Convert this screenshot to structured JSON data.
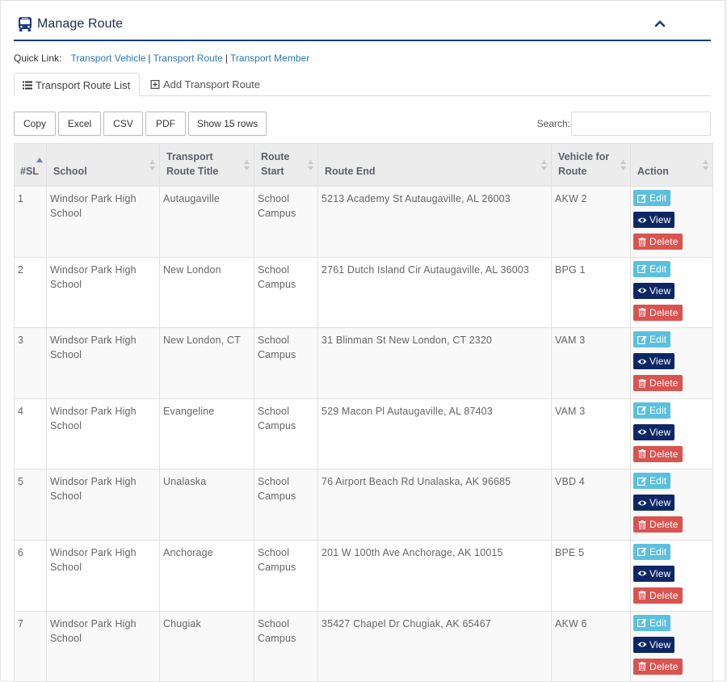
{
  "panel": {
    "title": "Manage Route",
    "title_icon": "bus-icon",
    "collapse_icon": "chevron-up-icon"
  },
  "quick_link": {
    "label": "Quick Link:",
    "links": [
      "Transport Vehicle",
      "Transport Route",
      "Transport Member"
    ],
    "separator": "|"
  },
  "tabs": [
    {
      "label": "Transport Route List",
      "icon": "list-icon",
      "active": true
    },
    {
      "label": "Add Transport Route",
      "icon": "plus-square-icon",
      "active": false
    }
  ],
  "toolbar": {
    "buttons": [
      "Copy",
      "Excel",
      "CSV",
      "PDF",
      "Show 15 rows"
    ],
    "search_label": "Search:",
    "search_value": ""
  },
  "table": {
    "columns": [
      "#SL",
      "School",
      "Transport Route Title",
      "Route Start",
      "Route End",
      "Vehicle for Route",
      "Action"
    ],
    "sorted_column": "#SL",
    "actions": {
      "edit": "Edit",
      "view": "View",
      "delete": "Delete"
    },
    "rows": [
      [
        "1",
        "Windsor Park High School",
        "Autaugaville",
        "School Campus",
        "5213 Academy St Autaugaville, AL 26003",
        "AKW 2"
      ],
      [
        "2",
        "Windsor Park High School",
        "New London",
        "School Campus",
        "2761 Dutch Island Cir Autaugaville, AL 36003",
        "BPG 1"
      ],
      [
        "3",
        "Windsor Park High School",
        "New London, CT",
        "School Campus",
        "31 Blinman St New London, CT 2320",
        "VAM 3"
      ],
      [
        "4",
        "Windsor Park High School",
        "Evangeline",
        "School Campus",
        "529 Macon Pl Autaugaville, AL 87403",
        "VAM 3"
      ],
      [
        "5",
        "Windsor Park High School",
        "Unalaska",
        "School Campus",
        "76 Airport Beach Rd Unalaska, AK 96685",
        "VBD 4"
      ],
      [
        "6",
        "Windsor Park High School",
        "Anchorage",
        "School Campus",
        "201 W 100th Ave Anchorage, AK 10015",
        "BPE 5"
      ],
      [
        "7",
        "Windsor Park High School",
        "Chugiak",
        "School Campus",
        "35427 Chapel Dr Chugiak, AK 65467",
        "AKW 6"
      ]
    ]
  },
  "colors": {
    "brand_navy": "#1b3b7a",
    "link": "#2a7ab6",
    "edit": "#5bc0de",
    "view": "#0d2766",
    "delete": "#d9534f"
  }
}
